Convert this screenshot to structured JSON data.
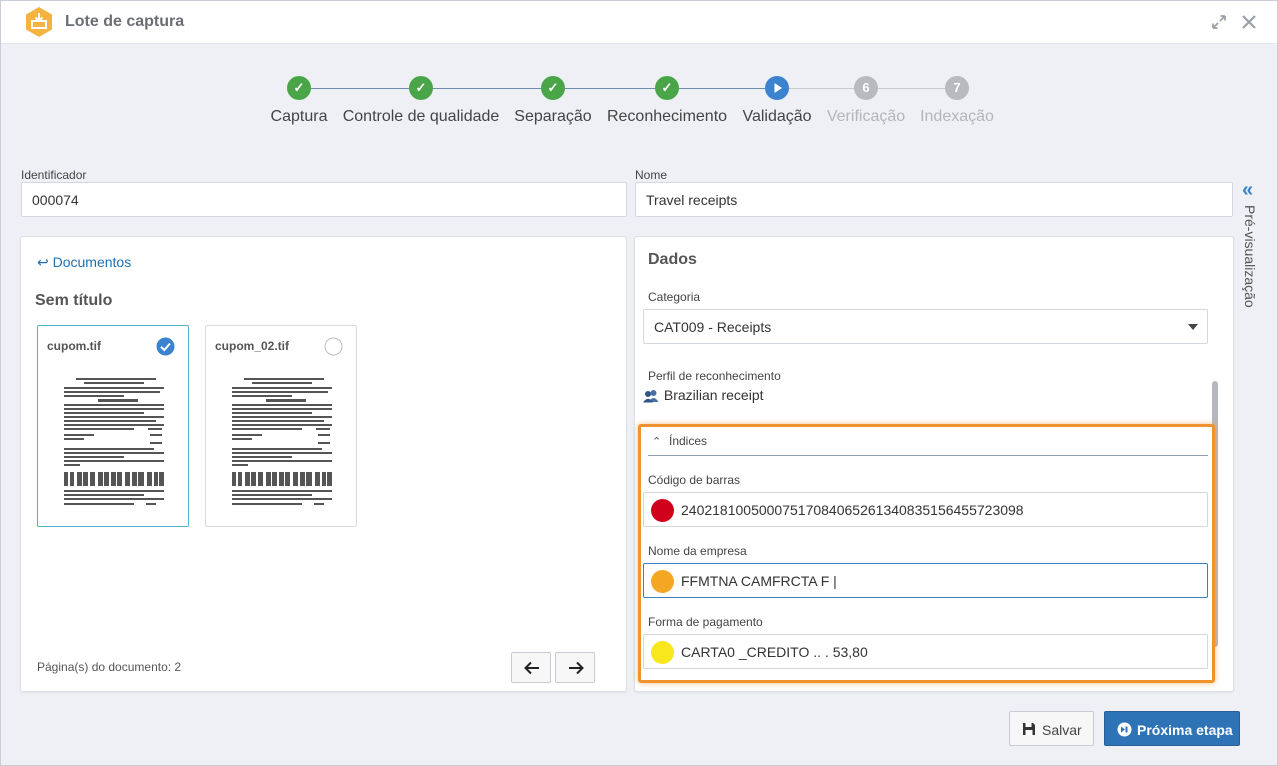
{
  "window": {
    "title": "Lote de captura"
  },
  "stepper": {
    "steps": [
      {
        "label": "Captura",
        "state": "done",
        "number": ""
      },
      {
        "label": "Controle de qualidade",
        "state": "done",
        "number": ""
      },
      {
        "label": "Separação",
        "state": "done",
        "number": ""
      },
      {
        "label": "Reconhecimento",
        "state": "done",
        "number": ""
      },
      {
        "label": "Validação",
        "state": "current",
        "number": ""
      },
      {
        "label": "Verificação",
        "state": "pending",
        "number": "6"
      },
      {
        "label": "Indexação",
        "state": "pending",
        "number": "7"
      }
    ],
    "colors": {
      "done": "#4aa548",
      "current": "#3b83cf",
      "pending": "#b8babd"
    }
  },
  "form": {
    "identificador_label": "Identificador",
    "identificador_value": "000074",
    "nome_label": "Nome",
    "nome_value": "Travel receipts"
  },
  "preview_tab": {
    "label": "Pré-visualização"
  },
  "documents_panel": {
    "back_link": "Documentos",
    "section_title": "Sem título",
    "docs": [
      {
        "name": "cupom.tif",
        "selected": true
      },
      {
        "name": "cupom_02.tif",
        "selected": false
      }
    ],
    "page_count": "Página(s) do documento: 2"
  },
  "data_panel": {
    "title": "Dados",
    "categoria_label": "Categoria",
    "categoria_value": "CAT009 - Receipts",
    "perfil_label": "Perfil de reconhecimento",
    "perfil_value": "Brazilian receipt",
    "indices_label": "Índices",
    "fields": [
      {
        "label": "Código de barras",
        "value": "24021810050007517084065261340835156455723098",
        "color": "#d0021b"
      },
      {
        "label": "Nome da empresa",
        "value": "FFMTNA CAMFRCTA F |",
        "color": "#f5a623"
      },
      {
        "label": "Forma de pagamento",
        "value": "CARTA0 _CREDITO .. . 53,80",
        "color": "#f8e71c"
      }
    ]
  },
  "footer": {
    "save_label": "Salvar",
    "next_label": "Próxima etapa"
  },
  "icons": {
    "app": "inbox-tray-icon",
    "expand": "expand-icon",
    "close": "close-icon",
    "preview": "double-chevron-left-icon",
    "profile": "users-icon",
    "save": "floppy-disk-icon",
    "next": "next-step-icon"
  },
  "colors": {
    "accent": "#2f73b7",
    "highlight": "#f0922e",
    "link": "#1f6fb5"
  }
}
